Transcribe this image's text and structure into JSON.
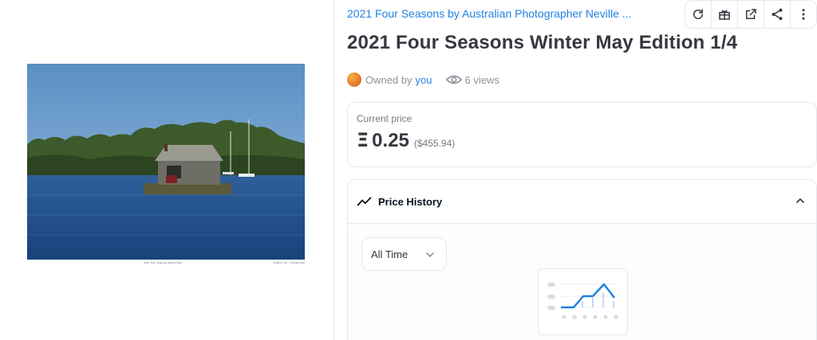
{
  "artwork": {
    "caption_left": "2021 Four Seasons Winter May",
    "caption_right": "Edition 1/4 — Neville Bell"
  },
  "collection": {
    "name": "2021 Four Seasons by Australian Photographer Neville ..."
  },
  "toolbar": {
    "icons": [
      "refresh-icon",
      "gift-icon",
      "external-link-icon",
      "share-icon",
      "more-icon"
    ]
  },
  "item": {
    "title": "2021 Four Seasons Winter May Edition 1/4",
    "owned_by_label": "Owned by",
    "owner": "you",
    "views": "6 views"
  },
  "price": {
    "label": "Current price",
    "symbol": "Ξ",
    "value": "0.25",
    "usd": "($455.94)"
  },
  "history": {
    "title": "Price History",
    "range_selected": "All Time"
  },
  "colors": {
    "accent": "#2081e2",
    "text": "#353840",
    "border": "#e5e8eb"
  }
}
